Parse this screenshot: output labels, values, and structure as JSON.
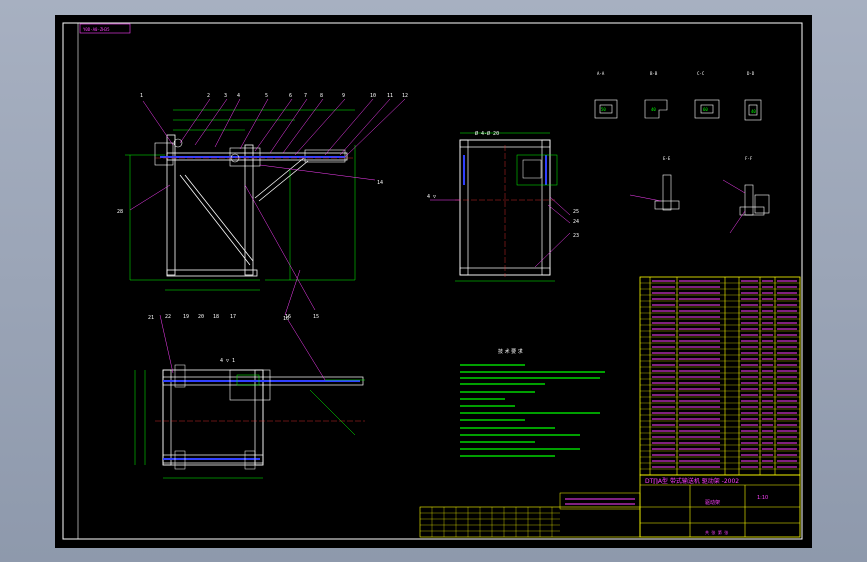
{
  "drawing": {
    "corner_tag": "Y0D-A0-ZH35",
    "colors": {
      "background": "#000000",
      "frame": "#ffffff",
      "outline": "#ffffff",
      "dimension": "#00ff00",
      "center_line": "#ff3030",
      "weld": "#3040ff",
      "leader": "#ff40ff",
      "title_text": "#ff40ff",
      "table_lines": "#ffff00"
    },
    "title_block": {
      "title": "DT∏A型 带式输送机 驱动架 -2002",
      "row_label": "驱动架",
      "scale": "1:10",
      "sheet": "共 张 第 张"
    },
    "notes_heading": "技 术 要 求",
    "section_labels": [
      "A-A",
      "B-B",
      "C-C",
      "D-D",
      "E-E",
      "F-F"
    ]
  }
}
